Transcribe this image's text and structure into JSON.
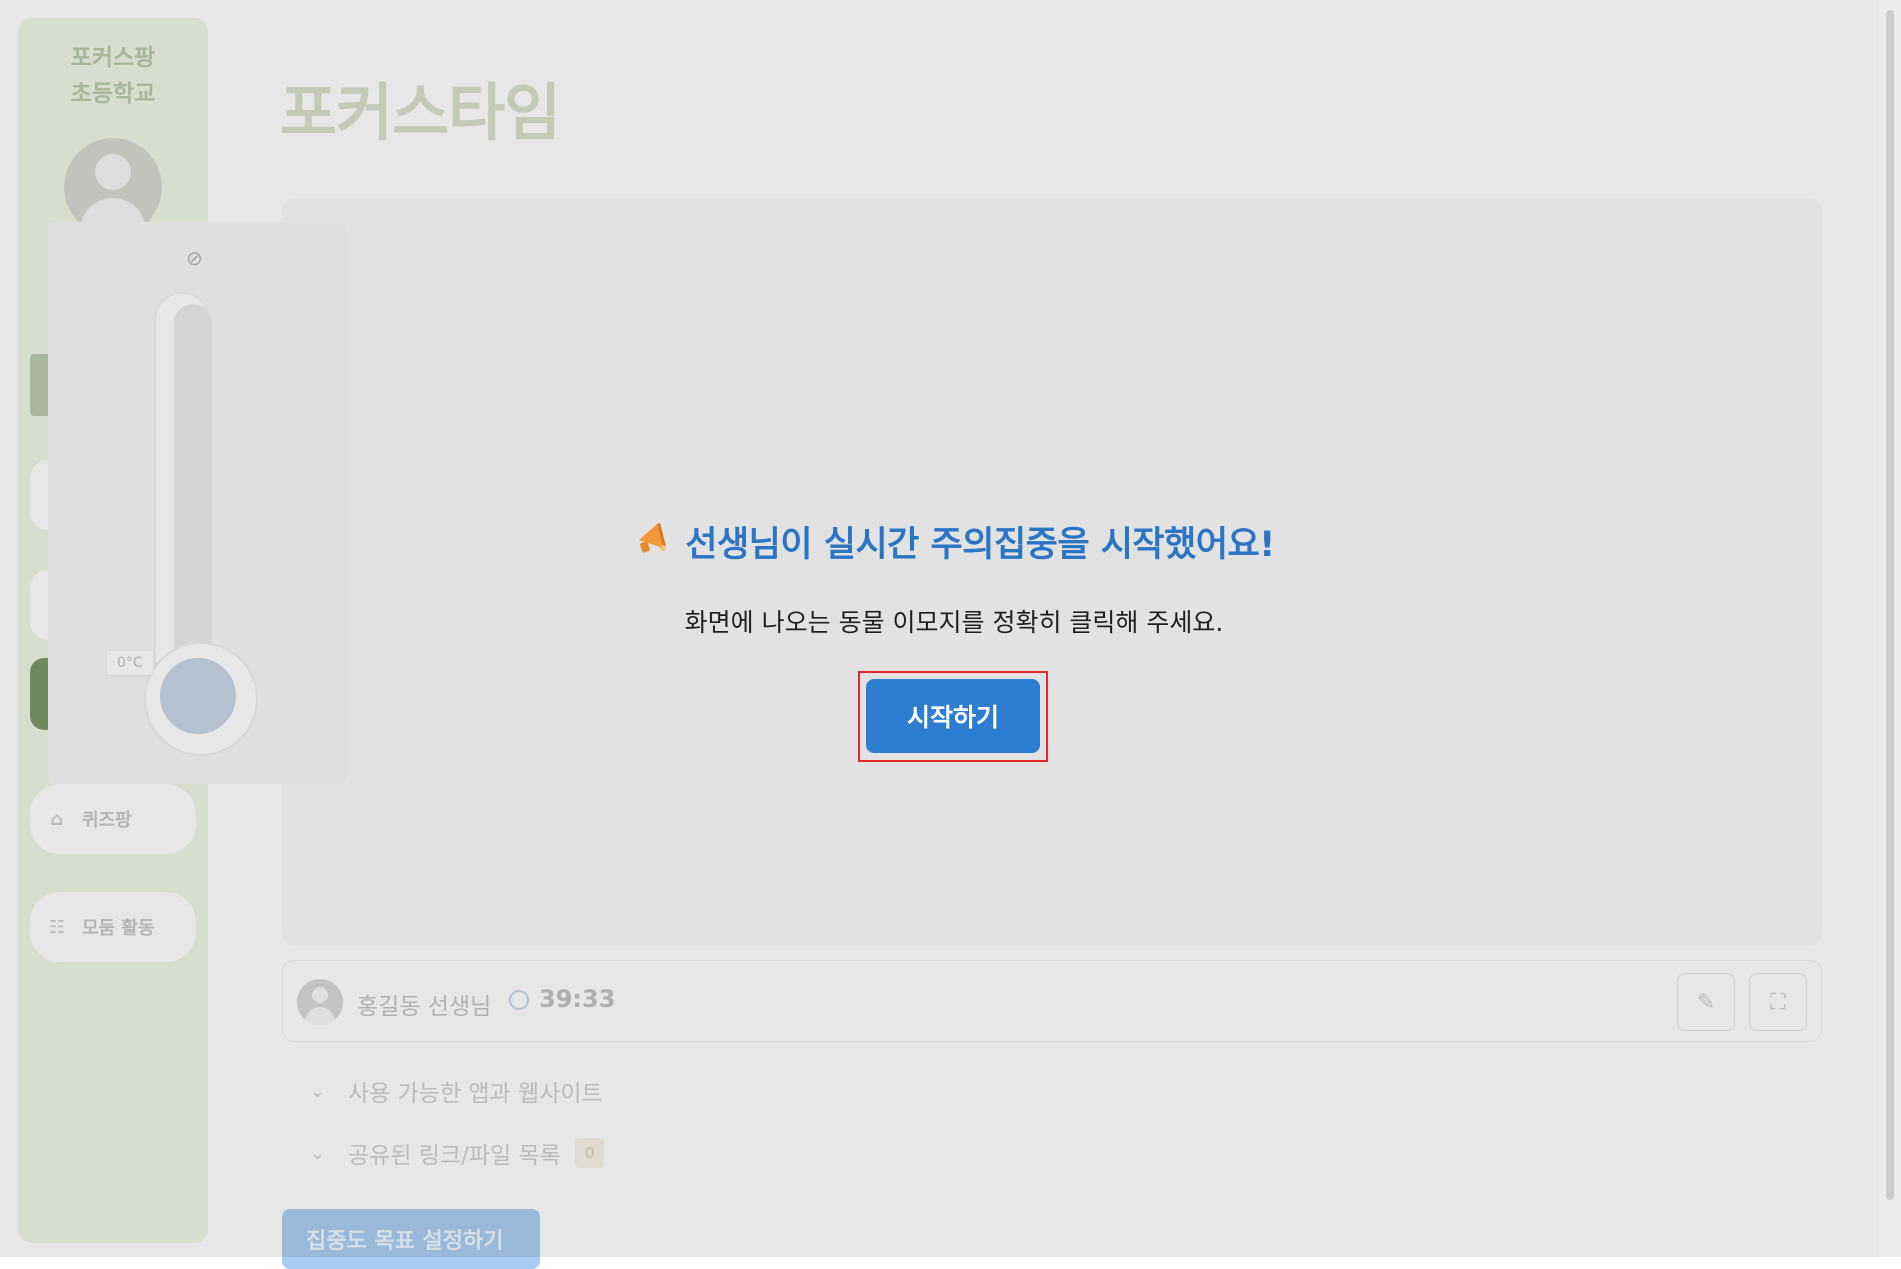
{
  "sidebar": {
    "school_name": "포커스팡\n초등학교",
    "items": [
      {
        "label": "퀴즈팡",
        "icon": "gamepad-icon"
      },
      {
        "label": "모둠 활동",
        "icon": "group-icon"
      }
    ]
  },
  "page": {
    "title": "포커스타임"
  },
  "session": {
    "teacher_name": "홍길동 선생님",
    "timer": "39:33"
  },
  "thermometer": {
    "temperature": "0°C"
  },
  "sections": {
    "apps_label": "사용 가능한 앱과 웹사이트",
    "links_label": "공유된 링크/파일 목록",
    "links_count": "0"
  },
  "goal_button_label": "집중도 목표 설정하기",
  "modal": {
    "icon": "megaphone-icon",
    "title": "선생님이 실시간 주의집중을 시작했어요!",
    "message": "화면에 나오는 동물 이모지를 정확히 클릭해 주세요.",
    "start_label": "시작하기"
  },
  "colors": {
    "accent": "#2d7ed2",
    "title_blue": "#2c75c5",
    "highlight": "#e5262b"
  }
}
